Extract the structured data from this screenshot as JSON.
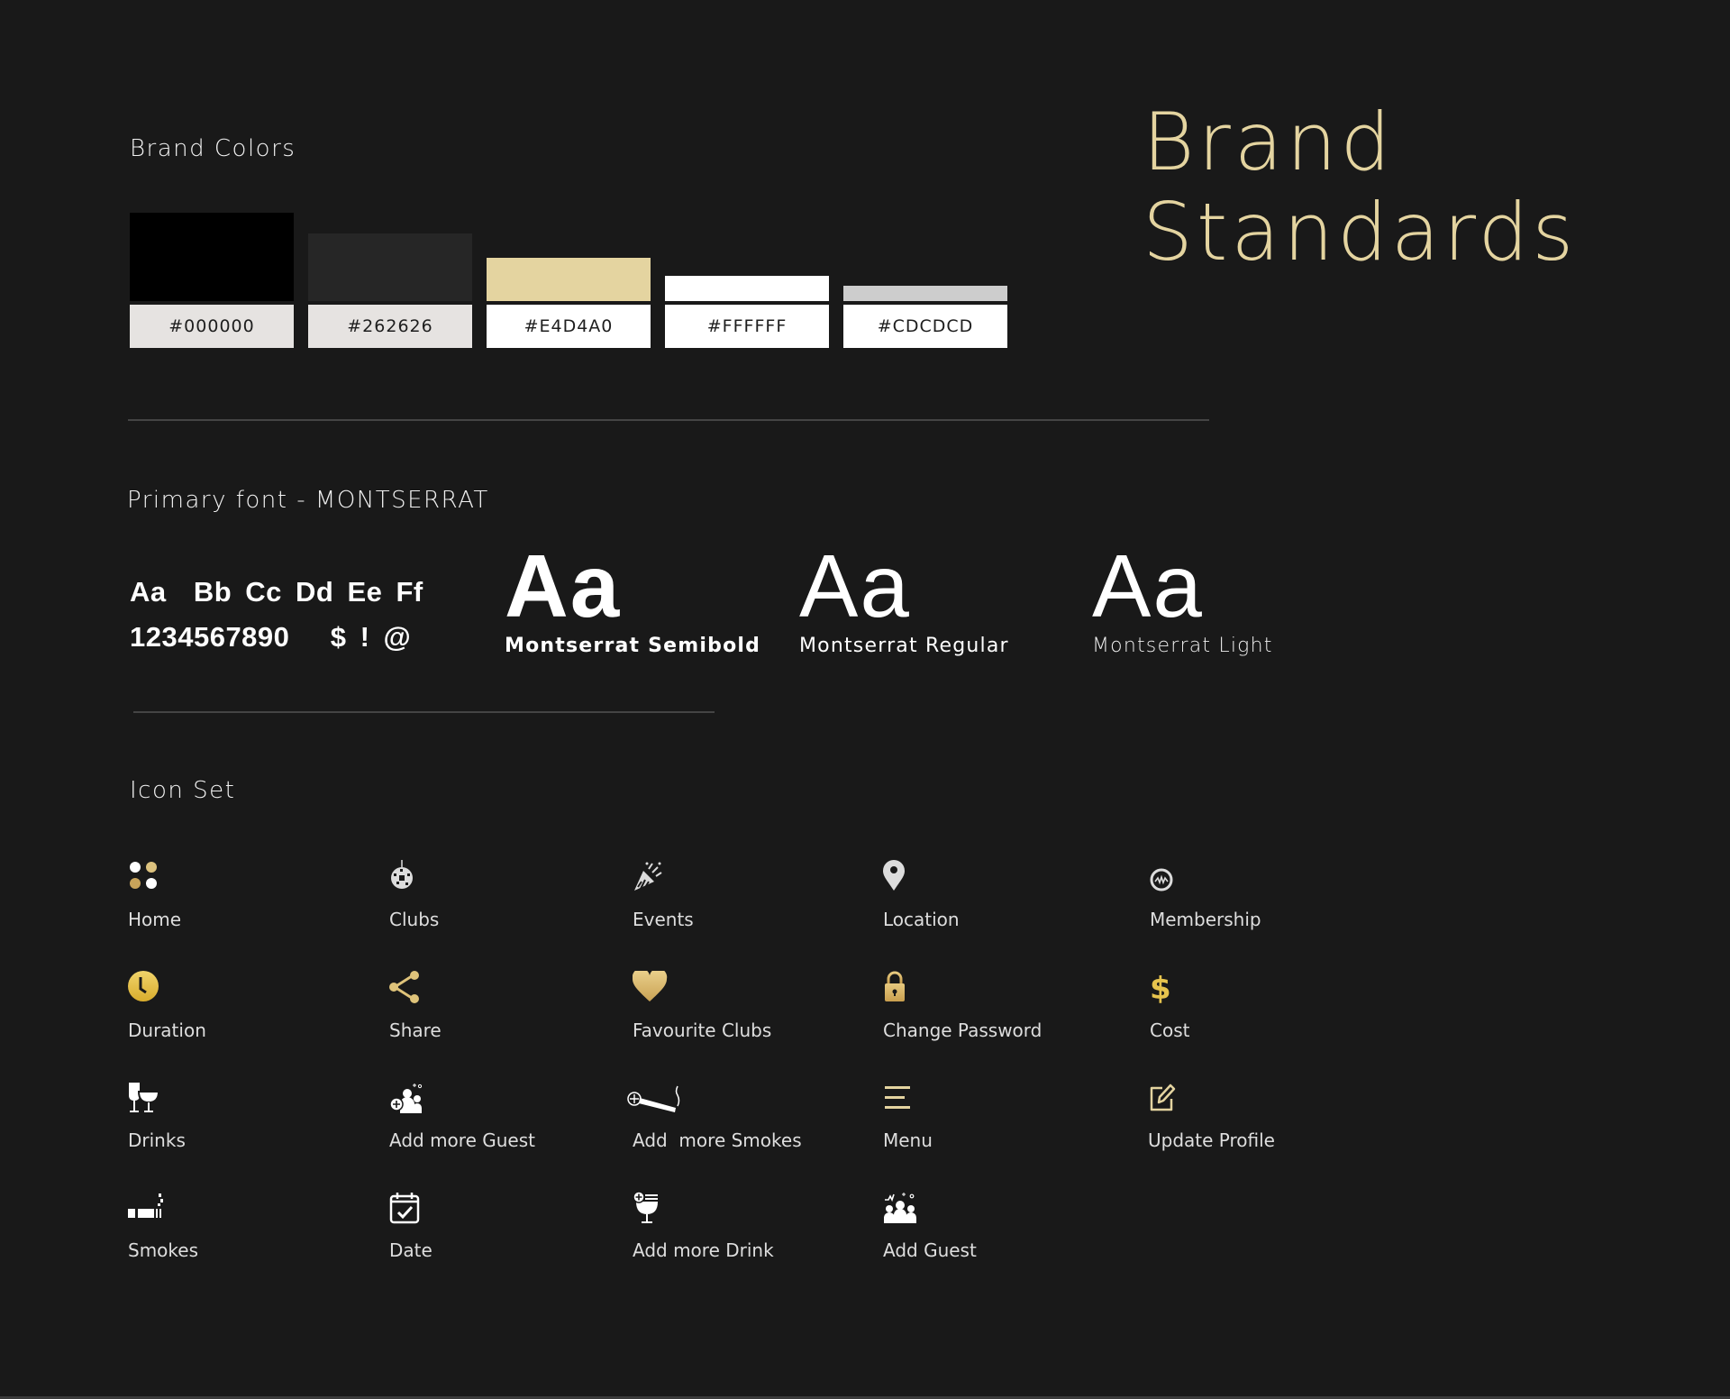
{
  "title": {
    "line1": "Brand",
    "line2": "Standards"
  },
  "brand_colors": {
    "heading": "Brand Colors",
    "swatches": [
      {
        "hex": "#000000",
        "label": "#000000"
      },
      {
        "hex": "#262626",
        "label": "#262626"
      },
      {
        "hex": "#E4D4A0",
        "label": "#E4D4A0"
      },
      {
        "hex": "#FFFFFF",
        "label": "#FFFFFF"
      },
      {
        "hex": "#CDCDCD",
        "label": "#CDCDCD"
      }
    ]
  },
  "typography": {
    "heading": "Primary font - MONTSERRAT",
    "specimen_line1": "Aa  Bb Cc Dd Ee Ff",
    "specimen_line2": "1234567890   $ ! @",
    "weights": [
      {
        "sample": "Aa",
        "name": "Montserrat Semibold"
      },
      {
        "sample": "Aa",
        "name": "Montserrat Regular"
      },
      {
        "sample": "Aa",
        "name": "Montserrat Light"
      }
    ]
  },
  "icon_set": {
    "heading": "Icon Set",
    "icons": [
      {
        "label": "Home",
        "icon": "home-dots-icon"
      },
      {
        "label": "Clubs",
        "icon": "disco-ball-icon"
      },
      {
        "label": "Events",
        "icon": "party-popper-icon"
      },
      {
        "label": "Location",
        "icon": "location-pin-icon"
      },
      {
        "label": "Membership",
        "icon": "membership-badge-icon"
      },
      {
        "label": "Duration",
        "icon": "clock-icon"
      },
      {
        "label": "Share",
        "icon": "share-icon"
      },
      {
        "label": "Favourite Clubs",
        "icon": "heart-icon"
      },
      {
        "label": "Change Password",
        "icon": "lock-icon"
      },
      {
        "label": "Cost",
        "icon": "dollar-icon"
      },
      {
        "label": "Drinks",
        "icon": "wine-glasses-icon"
      },
      {
        "label": "Add more Guest",
        "icon": "add-guest-icon"
      },
      {
        "label": "Add  more Smokes",
        "icon": "add-cigar-icon"
      },
      {
        "label": "Menu",
        "icon": "menu-icon"
      },
      {
        "label": "Update Profile",
        "icon": "edit-icon"
      },
      {
        "label": "Smokes",
        "icon": "cigarette-icon"
      },
      {
        "label": "Date",
        "icon": "calendar-check-icon"
      },
      {
        "label": "Add more Drink",
        "icon": "add-drink-icon"
      },
      {
        "label": "Add Guest",
        "icon": "guests-group-icon"
      }
    ]
  },
  "colors": {
    "background": "#191919",
    "accent_gold": "#E4D4A0",
    "icon_gold": "#D9B765",
    "icon_light": "#DCDCDC"
  }
}
